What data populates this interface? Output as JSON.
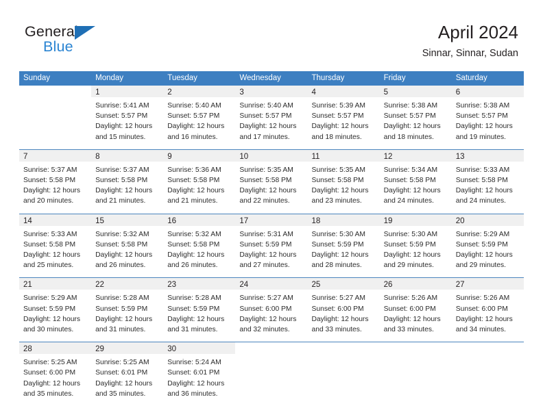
{
  "brand": {
    "name_top": "General",
    "name_bottom": "Blue",
    "accent_color": "#1f6fb5",
    "blue_text_color": "#2a84d2"
  },
  "header": {
    "title": "April 2024",
    "subtitle": "Sinnar, Sinnar, Sudan"
  },
  "theme": {
    "header_row_background": "#3d7fc1",
    "header_row_text": "#ffffff",
    "day_number_band": "#f0f0f0",
    "row_divider": "#4a84bd",
    "body_text": "#2b2b2b"
  },
  "weekdays": [
    "Sunday",
    "Monday",
    "Tuesday",
    "Wednesday",
    "Thursday",
    "Friday",
    "Saturday"
  ],
  "weeks": [
    [
      {
        "day": "",
        "lines": []
      },
      {
        "day": "1",
        "lines": [
          "Sunrise: 5:41 AM",
          "Sunset: 5:57 PM",
          "Daylight: 12 hours",
          "and 15 minutes."
        ]
      },
      {
        "day": "2",
        "lines": [
          "Sunrise: 5:40 AM",
          "Sunset: 5:57 PM",
          "Daylight: 12 hours",
          "and 16 minutes."
        ]
      },
      {
        "day": "3",
        "lines": [
          "Sunrise: 5:40 AM",
          "Sunset: 5:57 PM",
          "Daylight: 12 hours",
          "and 17 minutes."
        ]
      },
      {
        "day": "4",
        "lines": [
          "Sunrise: 5:39 AM",
          "Sunset: 5:57 PM",
          "Daylight: 12 hours",
          "and 18 minutes."
        ]
      },
      {
        "day": "5",
        "lines": [
          "Sunrise: 5:38 AM",
          "Sunset: 5:57 PM",
          "Daylight: 12 hours",
          "and 18 minutes."
        ]
      },
      {
        "day": "6",
        "lines": [
          "Sunrise: 5:38 AM",
          "Sunset: 5:57 PM",
          "Daylight: 12 hours",
          "and 19 minutes."
        ]
      }
    ],
    [
      {
        "day": "7",
        "lines": [
          "Sunrise: 5:37 AM",
          "Sunset: 5:58 PM",
          "Daylight: 12 hours",
          "and 20 minutes."
        ]
      },
      {
        "day": "8",
        "lines": [
          "Sunrise: 5:37 AM",
          "Sunset: 5:58 PM",
          "Daylight: 12 hours",
          "and 21 minutes."
        ]
      },
      {
        "day": "9",
        "lines": [
          "Sunrise: 5:36 AM",
          "Sunset: 5:58 PM",
          "Daylight: 12 hours",
          "and 21 minutes."
        ]
      },
      {
        "day": "10",
        "lines": [
          "Sunrise: 5:35 AM",
          "Sunset: 5:58 PM",
          "Daylight: 12 hours",
          "and 22 minutes."
        ]
      },
      {
        "day": "11",
        "lines": [
          "Sunrise: 5:35 AM",
          "Sunset: 5:58 PM",
          "Daylight: 12 hours",
          "and 23 minutes."
        ]
      },
      {
        "day": "12",
        "lines": [
          "Sunrise: 5:34 AM",
          "Sunset: 5:58 PM",
          "Daylight: 12 hours",
          "and 24 minutes."
        ]
      },
      {
        "day": "13",
        "lines": [
          "Sunrise: 5:33 AM",
          "Sunset: 5:58 PM",
          "Daylight: 12 hours",
          "and 24 minutes."
        ]
      }
    ],
    [
      {
        "day": "14",
        "lines": [
          "Sunrise: 5:33 AM",
          "Sunset: 5:58 PM",
          "Daylight: 12 hours",
          "and 25 minutes."
        ]
      },
      {
        "day": "15",
        "lines": [
          "Sunrise: 5:32 AM",
          "Sunset: 5:58 PM",
          "Daylight: 12 hours",
          "and 26 minutes."
        ]
      },
      {
        "day": "16",
        "lines": [
          "Sunrise: 5:32 AM",
          "Sunset: 5:58 PM",
          "Daylight: 12 hours",
          "and 26 minutes."
        ]
      },
      {
        "day": "17",
        "lines": [
          "Sunrise: 5:31 AM",
          "Sunset: 5:59 PM",
          "Daylight: 12 hours",
          "and 27 minutes."
        ]
      },
      {
        "day": "18",
        "lines": [
          "Sunrise: 5:30 AM",
          "Sunset: 5:59 PM",
          "Daylight: 12 hours",
          "and 28 minutes."
        ]
      },
      {
        "day": "19",
        "lines": [
          "Sunrise: 5:30 AM",
          "Sunset: 5:59 PM",
          "Daylight: 12 hours",
          "and 29 minutes."
        ]
      },
      {
        "day": "20",
        "lines": [
          "Sunrise: 5:29 AM",
          "Sunset: 5:59 PM",
          "Daylight: 12 hours",
          "and 29 minutes."
        ]
      }
    ],
    [
      {
        "day": "21",
        "lines": [
          "Sunrise: 5:29 AM",
          "Sunset: 5:59 PM",
          "Daylight: 12 hours",
          "and 30 minutes."
        ]
      },
      {
        "day": "22",
        "lines": [
          "Sunrise: 5:28 AM",
          "Sunset: 5:59 PM",
          "Daylight: 12 hours",
          "and 31 minutes."
        ]
      },
      {
        "day": "23",
        "lines": [
          "Sunrise: 5:28 AM",
          "Sunset: 5:59 PM",
          "Daylight: 12 hours",
          "and 31 minutes."
        ]
      },
      {
        "day": "24",
        "lines": [
          "Sunrise: 5:27 AM",
          "Sunset: 6:00 PM",
          "Daylight: 12 hours",
          "and 32 minutes."
        ]
      },
      {
        "day": "25",
        "lines": [
          "Sunrise: 5:27 AM",
          "Sunset: 6:00 PM",
          "Daylight: 12 hours",
          "and 33 minutes."
        ]
      },
      {
        "day": "26",
        "lines": [
          "Sunrise: 5:26 AM",
          "Sunset: 6:00 PM",
          "Daylight: 12 hours",
          "and 33 minutes."
        ]
      },
      {
        "day": "27",
        "lines": [
          "Sunrise: 5:26 AM",
          "Sunset: 6:00 PM",
          "Daylight: 12 hours",
          "and 34 minutes."
        ]
      }
    ],
    [
      {
        "day": "28",
        "lines": [
          "Sunrise: 5:25 AM",
          "Sunset: 6:00 PM",
          "Daylight: 12 hours",
          "and 35 minutes."
        ]
      },
      {
        "day": "29",
        "lines": [
          "Sunrise: 5:25 AM",
          "Sunset: 6:01 PM",
          "Daylight: 12 hours",
          "and 35 minutes."
        ]
      },
      {
        "day": "30",
        "lines": [
          "Sunrise: 5:24 AM",
          "Sunset: 6:01 PM",
          "Daylight: 12 hours",
          "and 36 minutes."
        ]
      },
      {
        "day": "",
        "lines": []
      },
      {
        "day": "",
        "lines": []
      },
      {
        "day": "",
        "lines": []
      },
      {
        "day": "",
        "lines": []
      }
    ]
  ]
}
